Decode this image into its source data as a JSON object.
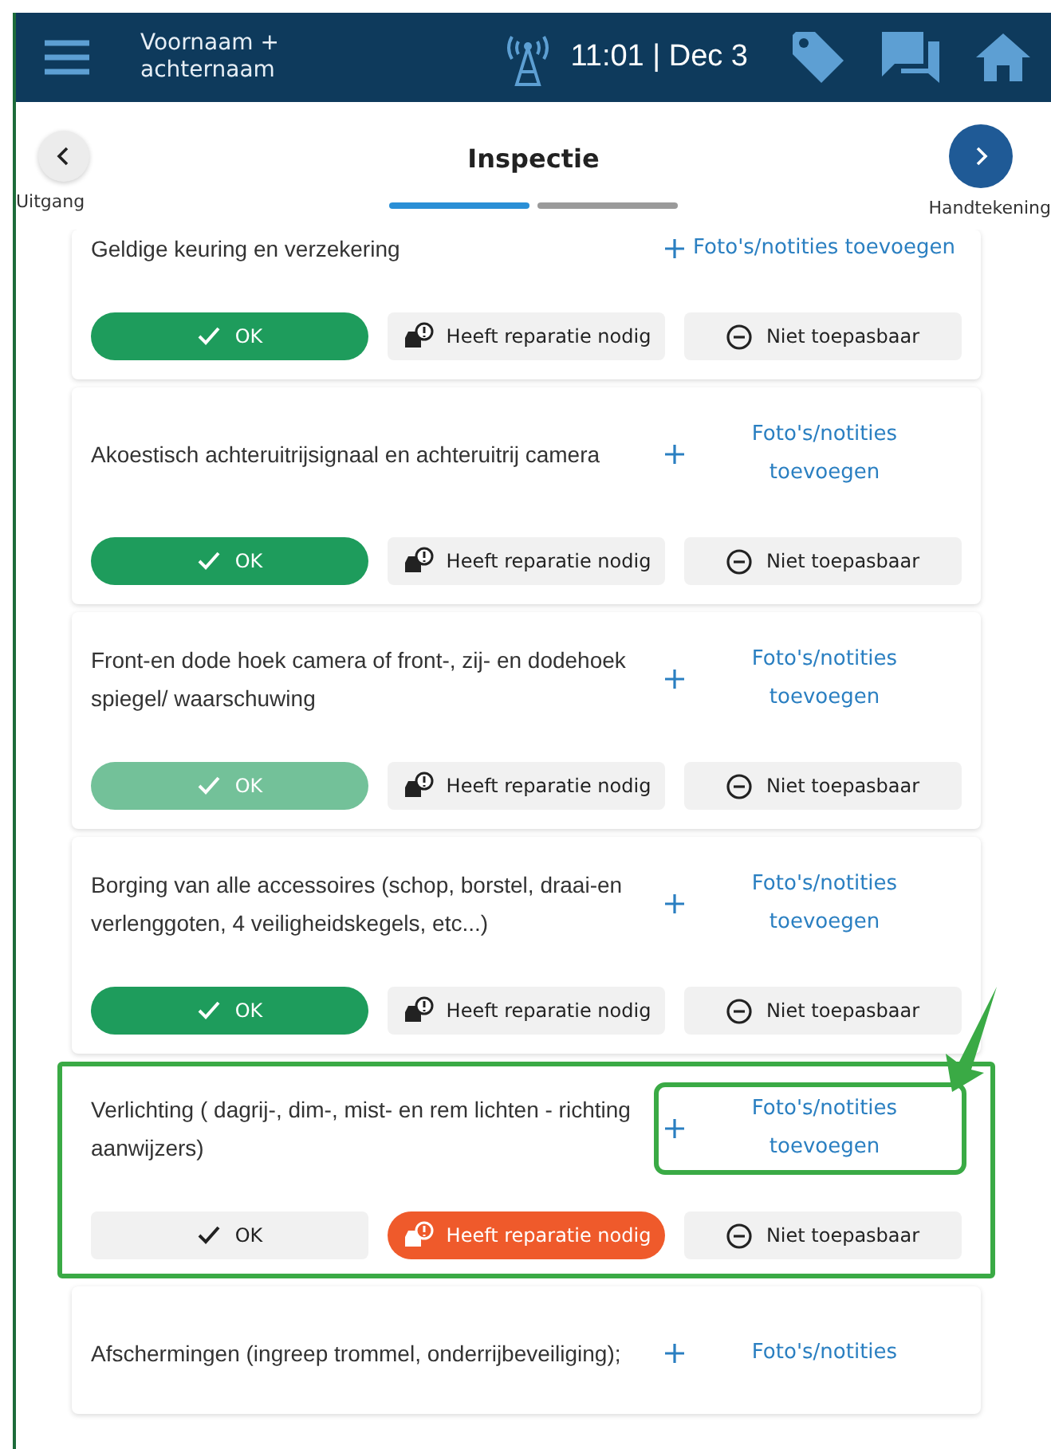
{
  "header": {
    "user_name": "Voornaam + achternaam",
    "time": "11:01 | Dec 3"
  },
  "nav": {
    "back_label": "Uitgang",
    "title": "Inspectie",
    "next_label": "Handtekening",
    "steps": [
      {
        "selected": true
      },
      {
        "selected": false
      }
    ]
  },
  "items": [
    {
      "title": "Geldige keuring en verzekering",
      "photo_button": "Foto's/notities toevoegen",
      "highlighted": false,
      "faded": false,
      "actions": [
        {
          "kind": "ok",
          "label": "OK",
          "selected": true
        },
        {
          "kind": "repair",
          "label": "Heeft reparatie nodig",
          "selected": false
        },
        {
          "kind": "na",
          "label": "Niet toepasbaar",
          "selected": false
        }
      ]
    },
    {
      "title": "Akoestisch achteruitrijsignaal en achteruitrij camera",
      "photo_button": "Foto's/notities toevoegen",
      "highlighted": false,
      "faded": false,
      "actions": [
        {
          "kind": "ok",
          "label": "OK",
          "selected": true
        },
        {
          "kind": "repair",
          "label": "Heeft reparatie nodig",
          "selected": false
        },
        {
          "kind": "na",
          "label": "Niet toepasbaar",
          "selected": false
        }
      ]
    },
    {
      "title": "Front-en dode hoek camera of front-, zij- en dodehoek spiegel/ waarschuwing",
      "photo_button": "Foto's/notities toevoegen",
      "highlighted": false,
      "faded": true,
      "actions": [
        {
          "kind": "ok",
          "label": "OK",
          "selected": true
        },
        {
          "kind": "repair",
          "label": "Heeft reparatie nodig",
          "selected": false
        },
        {
          "kind": "na",
          "label": "Niet toepasbaar",
          "selected": false
        }
      ]
    },
    {
      "title": "Borging van alle accessoires (schop, borstel, draai-en verlenggoten, 4 veiligheidskegels, etc...)",
      "photo_button": "Foto's/notities toevoegen",
      "highlighted": false,
      "faded": false,
      "actions": [
        {
          "kind": "ok",
          "label": "OK",
          "selected": true
        },
        {
          "kind": "repair",
          "label": "Heeft reparatie nodig",
          "selected": false
        },
        {
          "kind": "na",
          "label": "Niet toepasbaar",
          "selected": false
        }
      ]
    },
    {
      "title": "Verlichting ( dagrij-, dim-, mist- en rem lichten - richting aanwijzers)",
      "photo_button": "Foto's/notities toevoegen",
      "highlighted": true,
      "faded": false,
      "actions": [
        {
          "kind": "ok",
          "label": "OK",
          "selected": false
        },
        {
          "kind": "repair",
          "label": "Heeft reparatie nodig",
          "selected": true
        },
        {
          "kind": "na",
          "label": "Niet toepasbaar",
          "selected": false
        }
      ]
    },
    {
      "title": "Afschermingen (ingreep trommel, onderrijbeveiliging);",
      "photo_button": "Foto's/notities",
      "highlighted": false
    }
  ]
}
